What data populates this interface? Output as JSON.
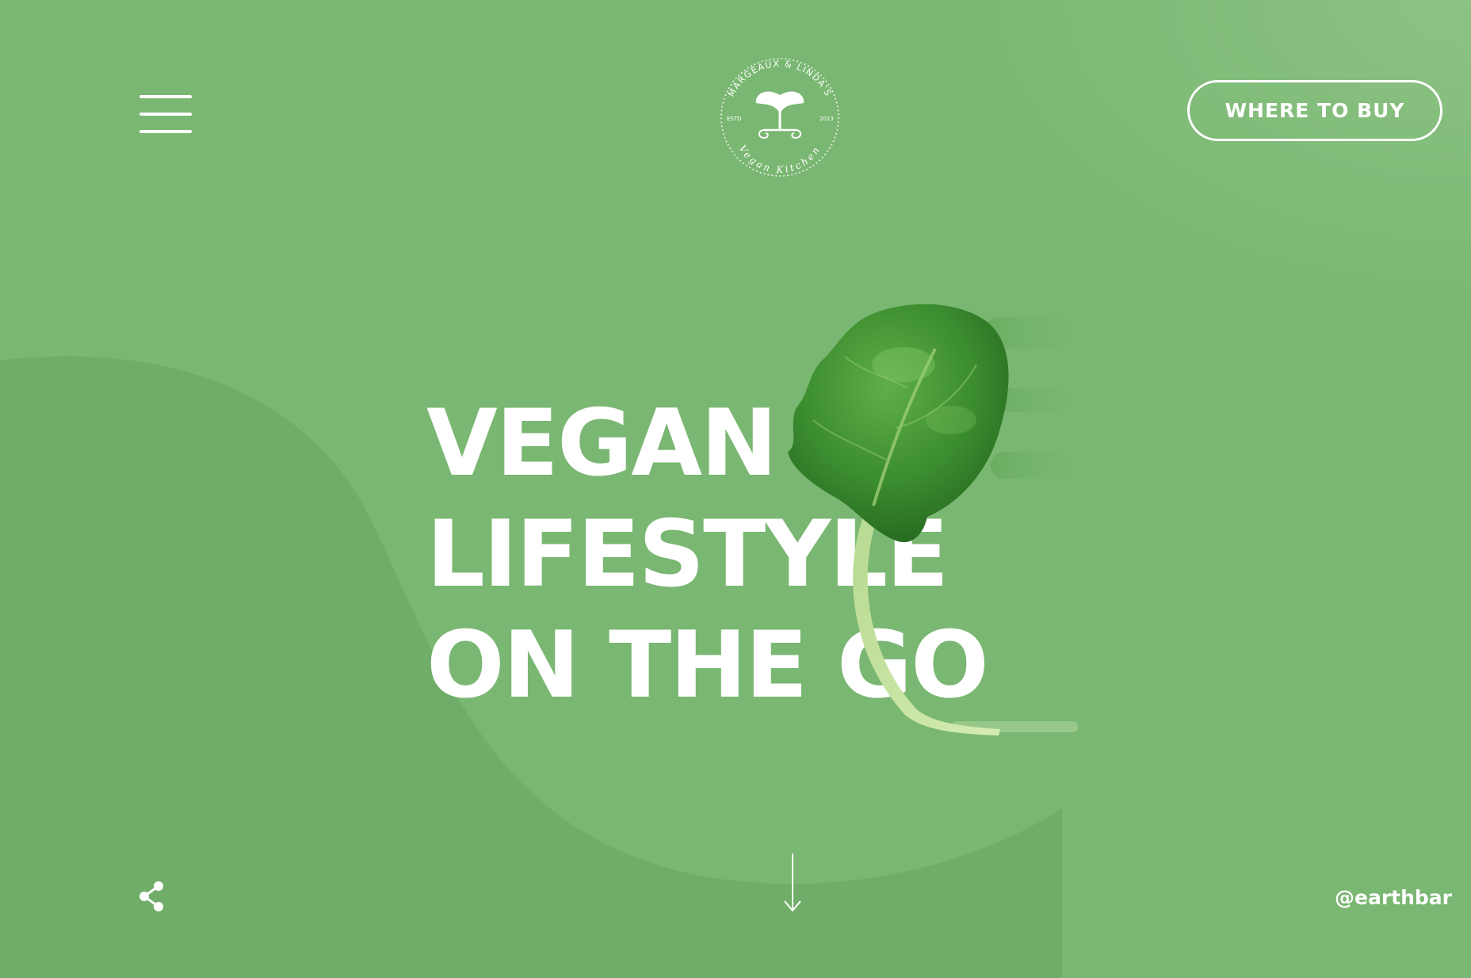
{
  "header": {
    "menu_icon": "hamburger-menu-icon",
    "logo": {
      "top_text": "MARGEAUX & LINDA'S",
      "bottom_text": "Vegan Kitchen",
      "left_small": "ESTD",
      "right_small": "2013",
      "icon": "sprout-icon"
    },
    "cta_label": "WHERE TO BUY"
  },
  "hero": {
    "lines": [
      "VEGAN",
      "LIFESTYLE",
      "ON THE GO"
    ],
    "image": "spinach-leaf-image"
  },
  "footer": {
    "share_icon": "share-icon",
    "scroll_icon": "arrow-down-icon",
    "social_handle": "@earthbar"
  },
  "colors": {
    "background": "#7ab772",
    "background_shape": "#70ad69",
    "text": "#ffffff",
    "leaf": "#3f8f35"
  }
}
